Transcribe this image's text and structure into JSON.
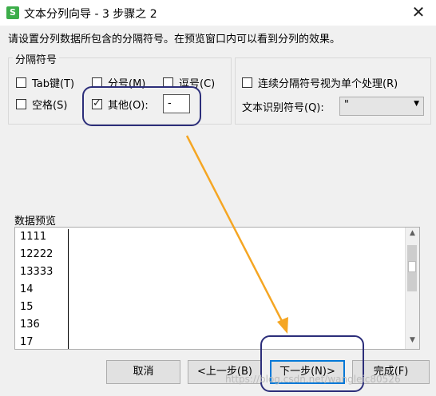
{
  "window": {
    "title": "文本分列向导 - 3 步骤之 2",
    "app_icon_letter": "S",
    "close_glyph": "✕"
  },
  "description": "请设置分列数据所包含的分隔符号。在预览窗口内可以看到分列的效果。",
  "delimiters": {
    "group_title": "分隔符号",
    "tab": {
      "label": "Tab键(T)",
      "checked": false
    },
    "semicolon": {
      "label": "分号(M)",
      "checked": false
    },
    "comma": {
      "label": "逗号(C)",
      "checked": false
    },
    "space": {
      "label": "空格(S)",
      "checked": false
    },
    "other": {
      "label": "其他(O):",
      "checked": true,
      "value": "-"
    }
  },
  "options": {
    "consecutive": {
      "label": "连续分隔符号视为单个处理(R)",
      "checked": false
    },
    "text_qualifier_label": "文本识别符号(Q):",
    "text_qualifier_value": "\""
  },
  "preview": {
    "label": "数据预览",
    "rows": [
      "1111",
      "12222",
      "13333",
      "14",
      "15",
      "136",
      "17"
    ]
  },
  "buttons": {
    "cancel": "取消",
    "back": "<上一步(B)",
    "next": "下一步(N)>",
    "finish": "完成(F)"
  },
  "watermark": "https://blog.csdn.net/wangleic80526",
  "colors": {
    "highlight_ring": "#2c2e7a",
    "annotation_arrow": "#f5a623",
    "checked_mark": "#222222"
  }
}
